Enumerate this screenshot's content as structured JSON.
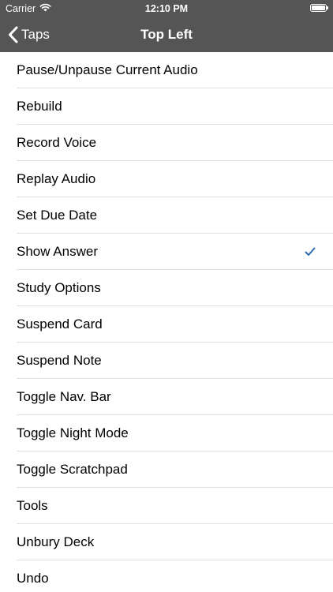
{
  "status_bar": {
    "carrier": "Carrier",
    "time": "12:10 PM",
    "wifi_icon": "wifi-icon",
    "battery_icon": "battery-icon",
    "battery_level": 1.0
  },
  "nav_bar": {
    "back_label": "Taps",
    "back_icon": "chevron-left-icon",
    "title": "Top Left"
  },
  "colors": {
    "bar_background": "#555555",
    "checkmark": "#2d6bb0",
    "divider": "#e0e0e0"
  },
  "list": {
    "items": [
      {
        "label": "Pause/Unpause Current Audio",
        "selected": false
      },
      {
        "label": "Rebuild",
        "selected": false
      },
      {
        "label": "Record Voice",
        "selected": false
      },
      {
        "label": "Replay Audio",
        "selected": false
      },
      {
        "label": "Set Due Date",
        "selected": false
      },
      {
        "label": "Show Answer",
        "selected": true
      },
      {
        "label": "Study Options",
        "selected": false
      },
      {
        "label": "Suspend Card",
        "selected": false
      },
      {
        "label": "Suspend Note",
        "selected": false
      },
      {
        "label": "Toggle Nav. Bar",
        "selected": false
      },
      {
        "label": "Toggle Night Mode",
        "selected": false
      },
      {
        "label": "Toggle Scratchpad",
        "selected": false
      },
      {
        "label": "Tools",
        "selected": false
      },
      {
        "label": "Unbury Deck",
        "selected": false
      },
      {
        "label": "Undo",
        "selected": false
      }
    ]
  }
}
